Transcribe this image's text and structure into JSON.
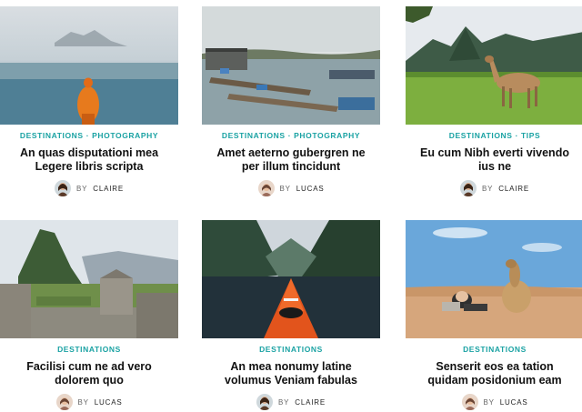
{
  "posts": [
    {
      "categories": [
        "DESTINATIONS",
        "PHOTOGRAPHY"
      ],
      "title": "An quas disputationi mea Legere libris scripta",
      "author_prefix": "BY",
      "author": "CLAIRE",
      "image": "person-in-orange-jacket-by-misty-lake"
    },
    {
      "categories": [
        "DESTINATIONS",
        "PHOTOGRAPHY"
      ],
      "title": "Amet aeterno gubergren ne per illum tincidunt",
      "author_prefix": "BY",
      "author": "LUCAS",
      "image": "floating-fishing-village-with-boats"
    },
    {
      "categories": [
        "DESTINATIONS",
        "TIPS"
      ],
      "title": "Eu cum Nibh everti vivendo ius ne",
      "author_prefix": "BY",
      "author": "CLAIRE",
      "image": "llama-at-machu-picchu"
    },
    {
      "categories": [
        "DESTINATIONS"
      ],
      "title": "Facilisi cum ne ad vero dolorem quo",
      "author_prefix": "BY",
      "author": "LUCAS",
      "image": "machu-picchu-ruins"
    },
    {
      "categories": [
        "DESTINATIONS"
      ],
      "title": "An mea nonumy latine volumus Veniam fabulas",
      "author_prefix": "BY",
      "author": "CLAIRE",
      "image": "orange-kayak-in-fjord"
    },
    {
      "categories": [
        "DESTINATIONS"
      ],
      "title": "Senserit eos ea tation quidam posidonium eam",
      "author_prefix": "BY",
      "author": "LUCAS",
      "image": "person-and-camel-in-desert"
    }
  ],
  "colors": {
    "category": "#1aa2a3",
    "title": "#111111",
    "meta": "#666666"
  }
}
